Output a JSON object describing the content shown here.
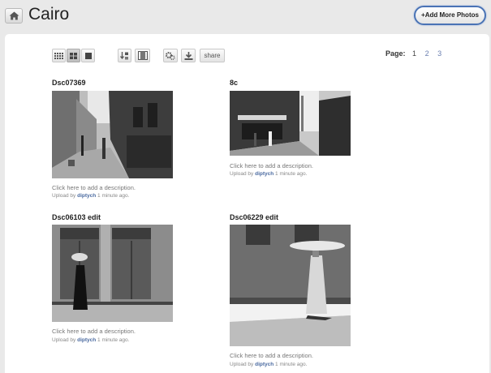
{
  "album": {
    "title": "Cairo"
  },
  "header": {
    "add_button_label": "+Add More Photos"
  },
  "toolbar": {
    "view_buttons": [
      "small-grid-icon",
      "medium-grid-icon",
      "large-view-icon"
    ],
    "sort_buttons": [
      "sort-icon",
      "filmstrip-icon"
    ],
    "action_buttons": [
      "settings-icon",
      "download-icon"
    ],
    "share_label": "share"
  },
  "pager": {
    "label": "Page:",
    "pages": [
      "1",
      "2",
      "3"
    ],
    "current": "1"
  },
  "photos": [
    {
      "title": "Dsc07369",
      "description": "Click here to add a description.",
      "upload_prefix": "Upload by",
      "uploader": "diptych",
      "time": "1 minute ago."
    },
    {
      "title": "8c",
      "description": "Click here to add a description.",
      "upload_prefix": "Upload by",
      "uploader": "diptych",
      "time": "1 minute ago."
    },
    {
      "title": "Dsc06103 edit",
      "description": "Click here to add a description.",
      "upload_prefix": "Upload by",
      "uploader": "diptych",
      "time": "1 minute ago."
    },
    {
      "title": "Dsc06229 edit",
      "description": "Click here to add a description.",
      "upload_prefix": "Upload by",
      "uploader": "diptych",
      "time": "1 minute ago."
    }
  ],
  "colors": {
    "accent": "#4a73b5",
    "link": "#4a6aa0",
    "background": "#e9e9e9"
  }
}
